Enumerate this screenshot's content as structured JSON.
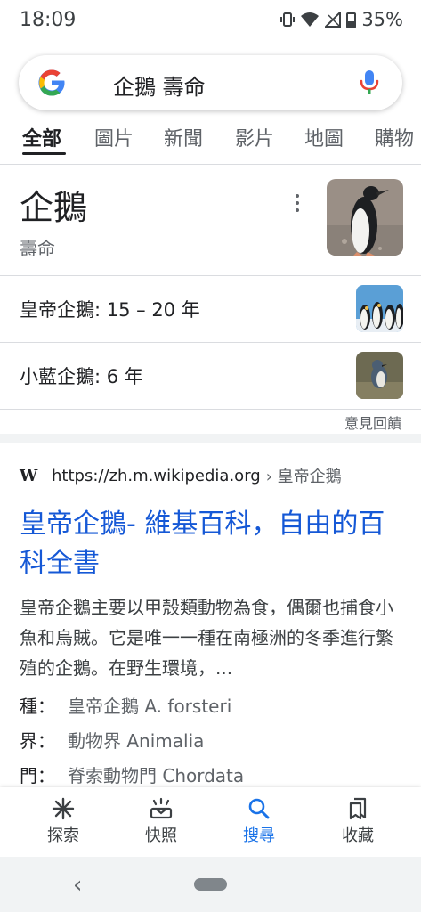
{
  "status": {
    "time": "18:09",
    "battery": "35%"
  },
  "search": {
    "query": "企鵝 壽命"
  },
  "tabs": [
    {
      "label": "全部"
    },
    {
      "label": "圖片"
    },
    {
      "label": "新聞"
    },
    {
      "label": "影片"
    },
    {
      "label": "地圖"
    },
    {
      "label": "購物"
    }
  ],
  "knowledge": {
    "title": "企鵝",
    "subtitle": "壽命",
    "rows": [
      {
        "label": "皇帝企鵝: 15 – 20 年"
      },
      {
        "label": "小藍企鵝: 6 年"
      }
    ],
    "feedback": "意見回饋"
  },
  "result": {
    "source_icon": "W",
    "url": "https://zh.m.wikipedia.org",
    "crumb": "› 皇帝企鵝",
    "title": "皇帝企鵝- 維基百科，自由的百科全書",
    "snippet": "皇帝企鵝主要以甲殼類動物為食，偶爾也捕食小魚和烏賊。它是唯一一種在南極洲的冬季進行繁殖的企鵝。在野生環境，...",
    "facts": [
      {
        "key": "種：",
        "value": "皇帝企鵝 A. forsteri"
      },
      {
        "key": "界：",
        "value": "動物界 Animalia"
      },
      {
        "key": "門：",
        "value": "脊索動物門 Chordata"
      }
    ]
  },
  "bottom_nav": [
    {
      "label": "探索",
      "icon": "asterisk-icon"
    },
    {
      "label": "快照",
      "icon": "snapshot-icon"
    },
    {
      "label": "搜尋",
      "icon": "search-icon"
    },
    {
      "label": "收藏",
      "icon": "bookmarks-icon"
    }
  ],
  "colors": {
    "link": "#1558d6",
    "active": "#1a73e8",
    "text": "#202124",
    "secondary": "#5f6368"
  }
}
